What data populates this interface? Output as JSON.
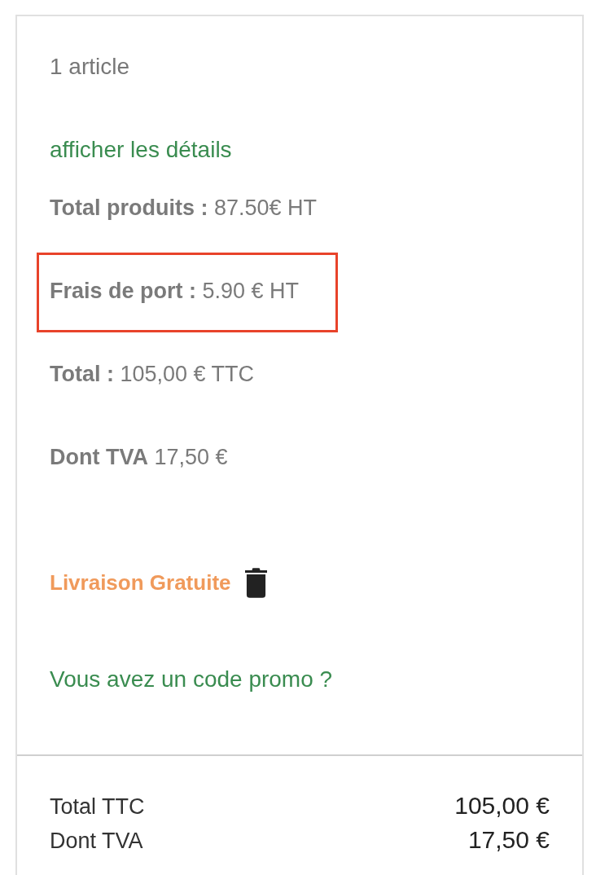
{
  "summary": {
    "item_count": "1 article",
    "details_link": "afficher les détails",
    "lines": [
      {
        "text": "**Total produits :** 87.50€ HT",
        "highlighted": false
      },
      {
        "text": "**Frais de port :** 5.90 € HT",
        "highlighted": true
      },
      {
        "text": "**Total :** 105,00 € TTC",
        "highlighted": false
      },
      {
        "text": "**Dont TVA** 17,50 €",
        "highlighted": false
      }
    ],
    "discount": {
      "label": "Livraison Gratuite"
    },
    "promo_link": "Vous avez un code promo ?"
  },
  "totals": [
    {
      "label": "Total TTC",
      "value": "105,00 €"
    },
    {
      "label": "Dont TVA",
      "value": "17,50 €"
    }
  ]
}
